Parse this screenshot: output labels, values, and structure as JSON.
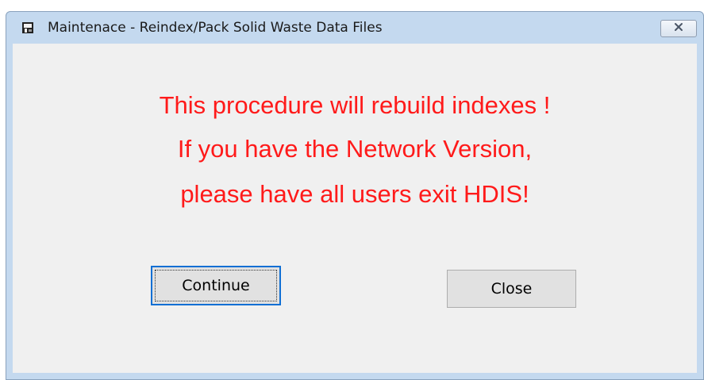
{
  "window": {
    "title": "Maintenace - Reindex/Pack Solid Waste Data Files",
    "icon": "app-icon"
  },
  "message": {
    "line1": "This procedure will rebuild indexes !",
    "line2": "If you have the Network Version,",
    "line3": "please have all users exit HDIS!",
    "color": "#ff1a1a"
  },
  "buttons": {
    "continue_label": "Continue",
    "close_label": "Close"
  }
}
